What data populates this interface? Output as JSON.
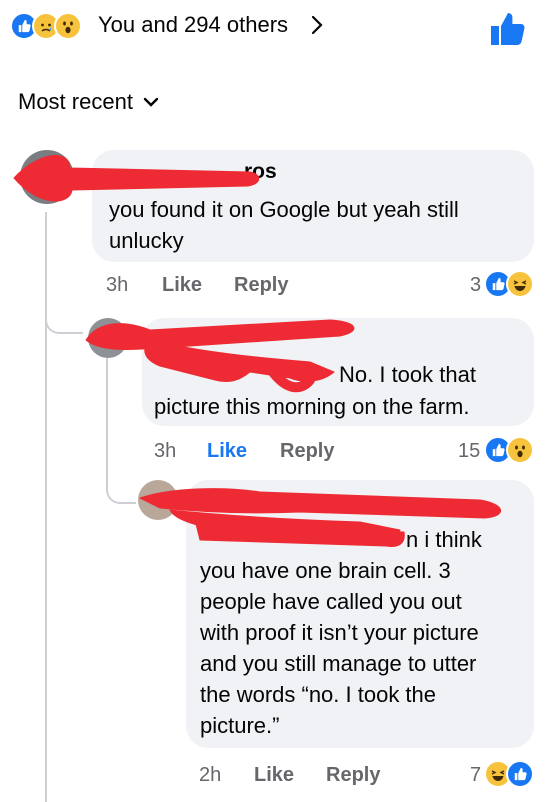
{
  "header": {
    "reaction_icons": [
      "like-icon",
      "sad-icon",
      "wow-icon"
    ],
    "count_text": "You and 294 others"
  },
  "sort": {
    "label": "Most recent"
  },
  "comments": [
    {
      "name": "ros",
      "text_line1": "you found it on Google but yeah still",
      "text_line2": "unlucky",
      "time": "3h",
      "like": "Like",
      "reply": "Reply",
      "reaction_count": "3",
      "reaction_icons": [
        "like-icon",
        "laugh-icon"
      ]
    },
    {
      "text_line1": "No. I took that",
      "text_line2": "picture this morning on the farm.",
      "time": "3h",
      "like": "Like",
      "reply": "Reply",
      "reaction_count": "15",
      "reaction_icons": [
        "like-icon",
        "wow-icon"
      ]
    },
    {
      "lines": [
        "n i think",
        "you have one brain cell. 3",
        "people have called you out",
        "with proof it isn’t your picture",
        "and you still manage to utter",
        "the words “no. I took the",
        "picture.”"
      ],
      "time": "2h",
      "like": "Like",
      "reply": "Reply",
      "reaction_count": "7",
      "reaction_icons": [
        "laugh-icon",
        "like-icon"
      ]
    }
  ],
  "colors": {
    "accent": "#1877f2",
    "bubble": "#f0f2f5",
    "redaction": "#ee2b34"
  }
}
